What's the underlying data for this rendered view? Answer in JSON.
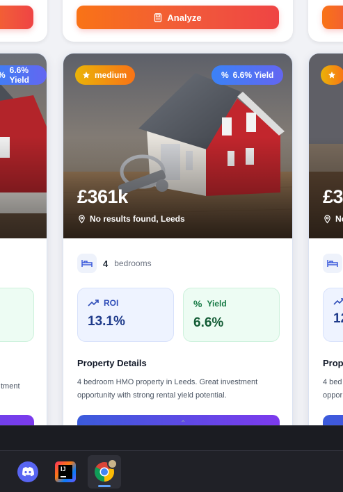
{
  "top_row": {
    "analyze_label": "Analyze"
  },
  "left_card": {
    "yield_badge": "6.6% Yield",
    "description_fragment": "tment"
  },
  "main_card": {
    "risk_badge": "medium",
    "yield_badge": "6.6% Yield",
    "price": "£361k",
    "location": "No results found, Leeds",
    "bedrooms_count": "4",
    "bedrooms_label": "bedrooms",
    "roi_label": "ROI",
    "roi_value": "13.1%",
    "yield_label": "Yield",
    "yield_value": "6.6%",
    "details_heading": "Property Details",
    "details_text": "4 bedroom HMO property in Leeds. Great investment opportunity with strong rental yield potential."
  },
  "right_card": {
    "price_fragment": "£3",
    "location_fragment": "No",
    "roi_value_fragment": "12",
    "details_heading_fragment": "Prope",
    "details_line1_fragment": "4 bed",
    "details_line2_fragment": "oppor"
  },
  "taskbar": {
    "apps": [
      "Discord",
      "IntelliJ IDEA",
      "Google Chrome"
    ],
    "intellij_glyph": "IJ"
  },
  "colors": {
    "analyze_gradient": [
      "#f97316",
      "#ef4444"
    ],
    "yield_badge": "#3b82f6",
    "risk_badge": "#eab308",
    "roi_text": "#1e3a8a",
    "yield_text": "#135c35"
  }
}
